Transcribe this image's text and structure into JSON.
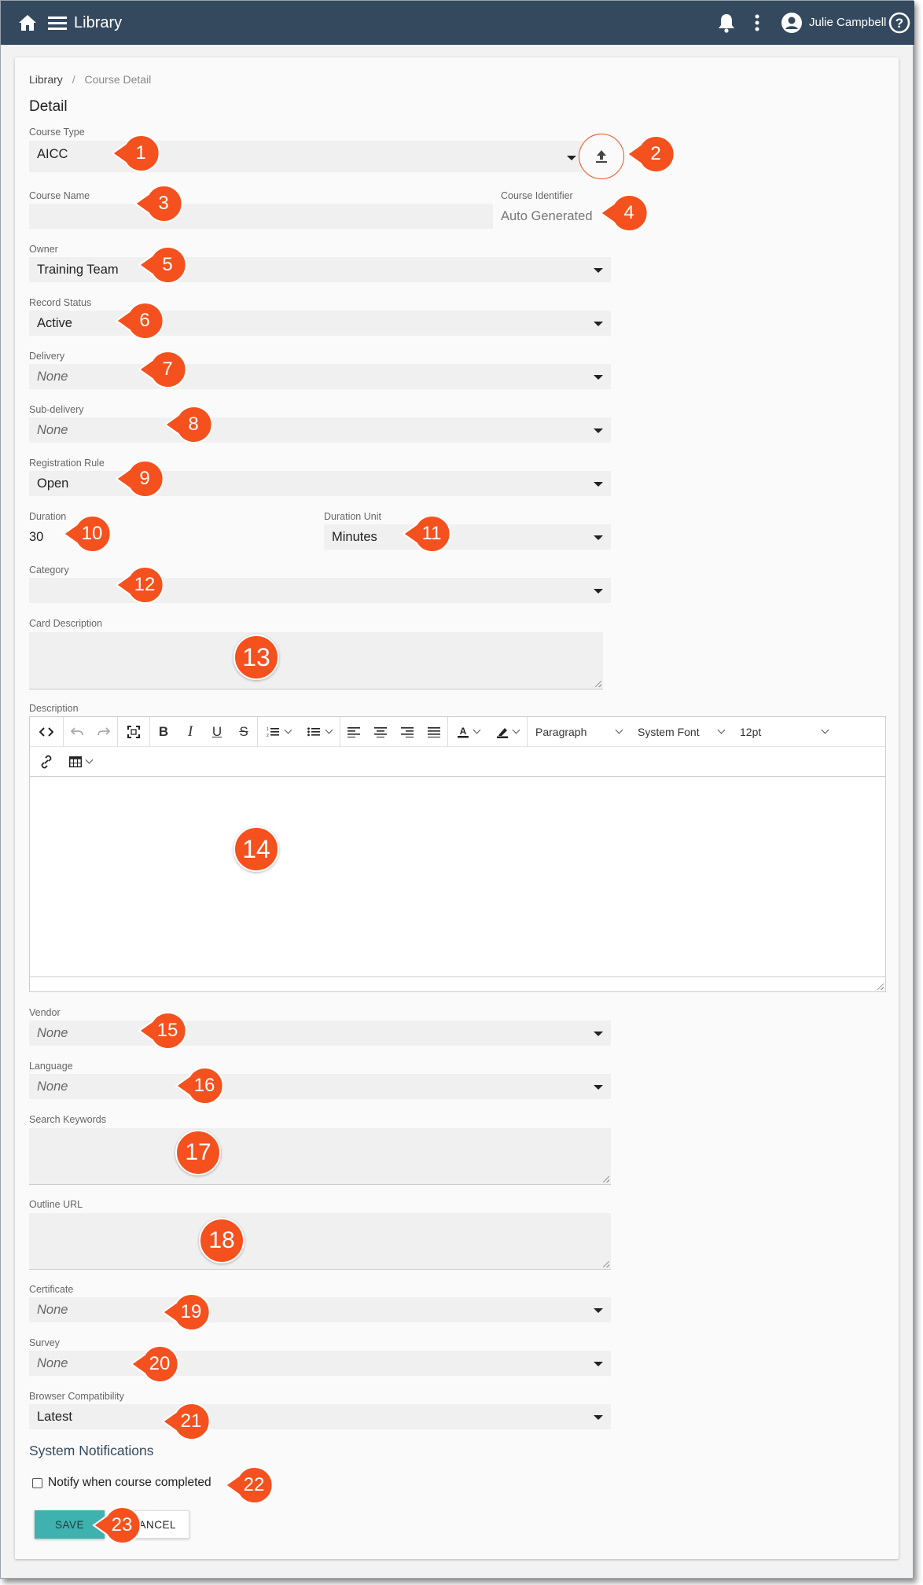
{
  "app": {
    "title": "Library",
    "user": "Julie Campbell"
  },
  "breadcrumb": {
    "root": "Library",
    "sep": "/",
    "current": "Course Detail"
  },
  "section_title": "Detail",
  "fields": {
    "course_type": {
      "label": "Course Type",
      "value": "AICC"
    },
    "course_name": {
      "label": "Course Name",
      "value": ""
    },
    "course_identifier": {
      "label": "Course Identifier",
      "value": "Auto Generated"
    },
    "owner": {
      "label": "Owner",
      "value": "Training Team"
    },
    "record_status": {
      "label": "Record Status",
      "value": "Active"
    },
    "delivery": {
      "label": "Delivery",
      "value": "None"
    },
    "sub_delivery": {
      "label": "Sub-delivery",
      "value": "None"
    },
    "registration_rule": {
      "label": "Registration Rule",
      "value": "Open"
    },
    "duration": {
      "label": "Duration",
      "value": "30"
    },
    "duration_unit": {
      "label": "Duration Unit",
      "value": "Minutes"
    },
    "category": {
      "label": "Category",
      "value": ""
    },
    "card_description": {
      "label": "Card Description",
      "value": ""
    },
    "description": {
      "label": "Description"
    },
    "vendor": {
      "label": "Vendor",
      "value": "None"
    },
    "language": {
      "label": "Language",
      "value": "None"
    },
    "search_keywords": {
      "label": "Search Keywords",
      "value": ""
    },
    "outline_url": {
      "label": "Outline URL",
      "value": ""
    },
    "certificate": {
      "label": "Certificate",
      "value": "None"
    },
    "survey": {
      "label": "Survey",
      "value": "None"
    },
    "browser_compatibility": {
      "label": "Browser Compatibility",
      "value": "Latest"
    }
  },
  "editor": {
    "block_format": "Paragraph",
    "font": "System Font",
    "size": "12pt"
  },
  "notifications": {
    "title": "System Notifications",
    "notify_label": "Notify when course completed",
    "checked": false
  },
  "actions": {
    "save": "SAVE",
    "cancel": "CANCEL"
  },
  "callouts": [
    "1",
    "2",
    "3",
    "4",
    "5",
    "6",
    "7",
    "8",
    "9",
    "10",
    "11",
    "12",
    "13",
    "14",
    "15",
    "16",
    "17",
    "18",
    "19",
    "20",
    "21",
    "22",
    "23"
  ],
  "colors": {
    "topbar": "#34495e",
    "callout": "#f4511e",
    "save": "#3fb2b0"
  }
}
